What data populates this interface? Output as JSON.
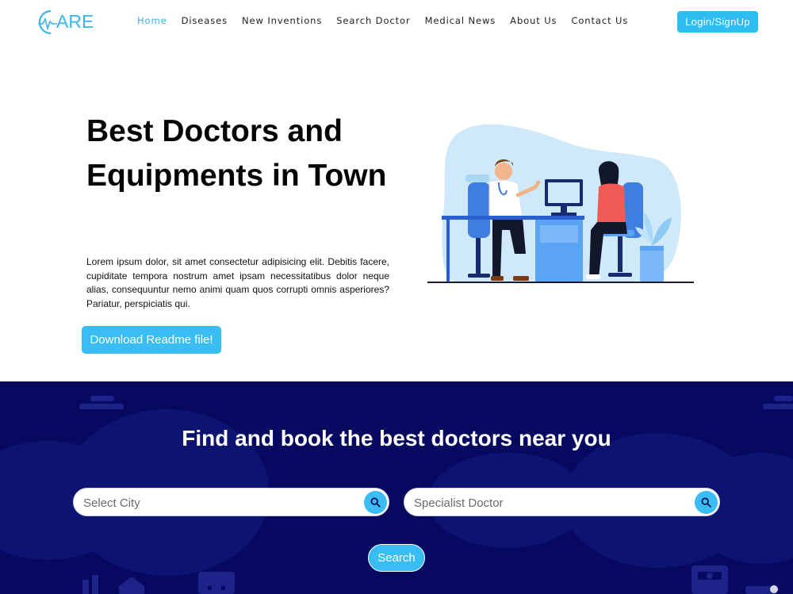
{
  "brand": {
    "logo_text": "ARE"
  },
  "nav": {
    "items": [
      {
        "label": "Home"
      },
      {
        "label": "Diseases"
      },
      {
        "label": "New Inventions"
      },
      {
        "label": "Search Doctor"
      },
      {
        "label": "Medical News"
      },
      {
        "label": "About Us"
      },
      {
        "label": "Contact Us"
      }
    ],
    "login_label": "Login/SignUp"
  },
  "hero": {
    "title": "Best Doctors and Equipments in Town",
    "paragraph": "Lorem ipsum dolor, sit amet consectetur adipisicing elit. Debitis facere, cupiditate tempora nostrum amet ipsam necessitatibus dolor neque alias, consequuntur nemo animi quam quos corrupti omnis asperiores? Pariatur, perspiciatis qui.",
    "download_label": "Download Readme file!"
  },
  "search": {
    "heading": "Find and book the best doctors near you",
    "city_placeholder": "Select City",
    "specialist_placeholder": "Specialist Doctor",
    "button_label": "Search"
  },
  "colors": {
    "accent": "#39bdf2",
    "nav_active": "#3ab0e8",
    "search_bg": "#070860"
  },
  "icons": [
    "search-icon",
    "heartbeat-icon"
  ]
}
